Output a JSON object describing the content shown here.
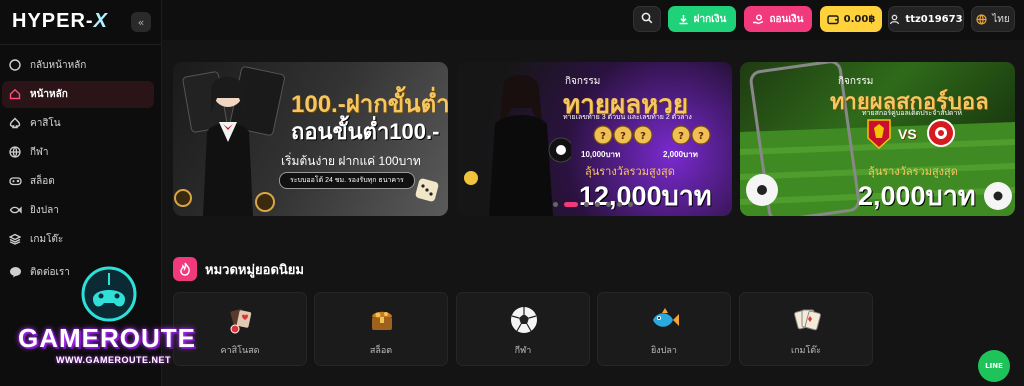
{
  "brand": {
    "logo_left": "HYPER-",
    "logo_x": "X"
  },
  "sidebar": {
    "collapse_label": "«",
    "items": [
      {
        "label": "กลับหน้าหลัก",
        "icon": "circle-icon",
        "active": false
      },
      {
        "label": "หน้าหลัก",
        "icon": "home-icon",
        "active": true
      },
      {
        "label": "คาสิโน",
        "icon": "spade-icon",
        "active": false
      },
      {
        "label": "กีฬา",
        "icon": "ball-icon",
        "active": false
      },
      {
        "label": "สล็อต",
        "icon": "gamepad-icon",
        "active": false
      },
      {
        "label": "ยิงปลา",
        "icon": "fish-icon",
        "active": false
      },
      {
        "label": "เกมโต๊ะ",
        "icon": "layers-icon",
        "active": false
      },
      {
        "label": "ติดต่อเรา",
        "icon": "line-chat-icon",
        "active": false
      }
    ]
  },
  "topbar": {
    "deposit_label": "ฝากเงิน",
    "withdraw_label": "ถอนเงิน",
    "balance": "0.00฿",
    "username": "ttz019673",
    "language": "ไทย"
  },
  "banners": {
    "b1": {
      "line1": "100.-ฝากขั้นต่ำ",
      "line2": "ถอนขั้นต่ำ100.-",
      "line3": "เริ่มต้นง่าย ฝากแค่ 100บาท",
      "line4": "ระบบออโต้ 24 ชม. รองรับทุก ธนาคาร"
    },
    "b2": {
      "small": "กิจกรรม",
      "title": "ทายผลหวย",
      "sub": "ทายเลขท้าย 3 ตัวบน และเลขท้าย 2 ตัวล่าง",
      "prize1": "10,000บาท",
      "prize2": "2,000บาท",
      "cap": "ลุ้นรางวัลรวมสูงสุด",
      "amount": "12,000บาท"
    },
    "b3": {
      "small": "กิจกรรม",
      "title": "ทายผลสกอร์บอล",
      "sub": "ทายสกอร์คู่บอลเด็ดประจำสัปดาห์",
      "vs": "VS",
      "cap": "ลุ้นรางวัลรวมสูงสุด",
      "amount": "2,000บาท"
    }
  },
  "carousel": {
    "slides": 7,
    "active_index": 1
  },
  "categories": {
    "title": "หมวดหมู่ยอดนิยม",
    "items": [
      {
        "label": "คาสิโนสด",
        "icon": "casino-chips-icon"
      },
      {
        "label": "สล็อต",
        "icon": "treasure-chest-icon"
      },
      {
        "label": "กีฬา",
        "icon": "soccer-ball-icon"
      },
      {
        "label": "ยิงปลา",
        "icon": "fish-icon"
      },
      {
        "label": "เกมโต๊ะ",
        "icon": "playing-cards-icon"
      }
    ]
  },
  "watermark": {
    "name": "GAMEROUTE",
    "url": "WWW.GAMEROUTE.NET"
  },
  "line_button": {
    "label": "LINE"
  },
  "colors": {
    "deposit": "#1fd27a",
    "withdraw": "#f13a7c",
    "wallet": "#ffd23c",
    "accent": "#f13a7c",
    "gold": "#f7c660"
  }
}
